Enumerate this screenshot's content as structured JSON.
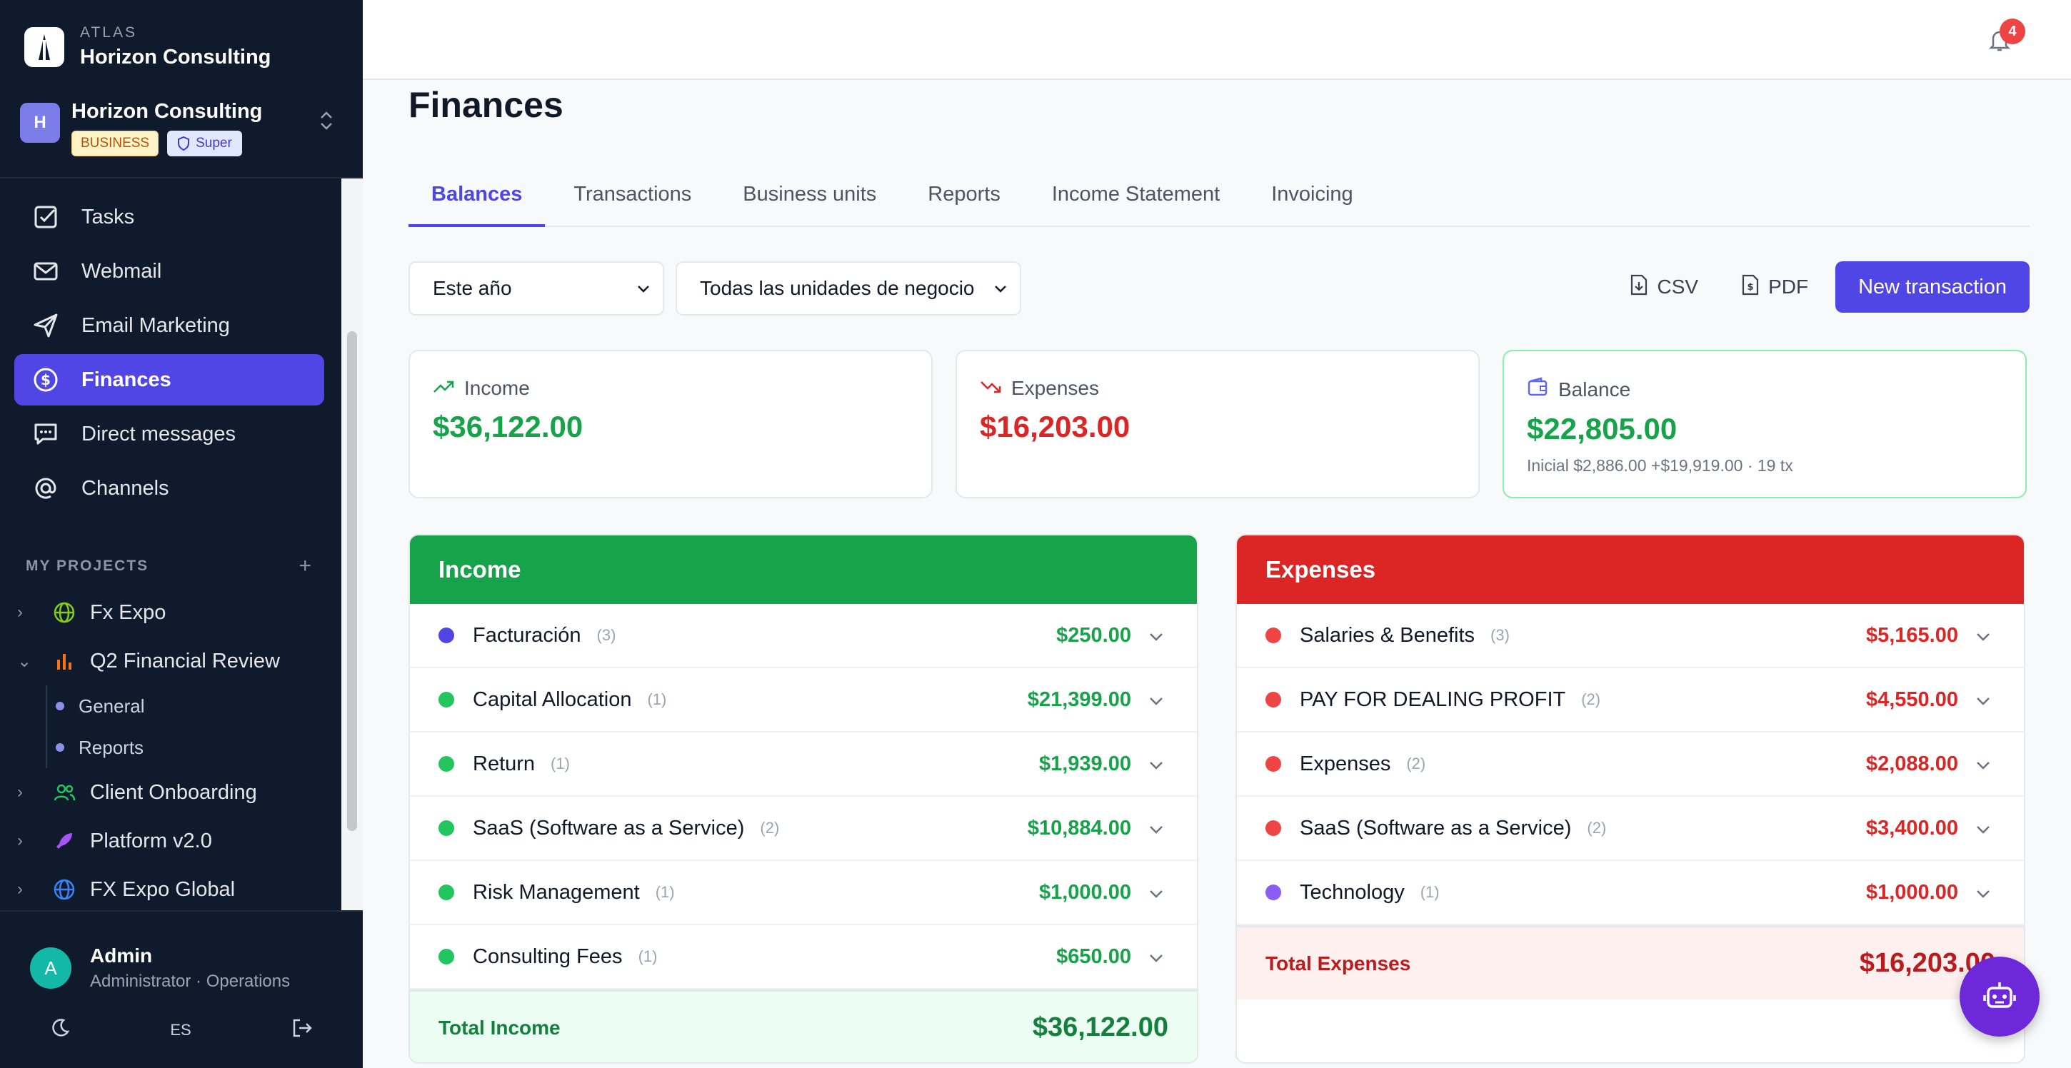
{
  "sidebar": {
    "brand_small": "ATLAS",
    "brand_name": "Horizon Consulting",
    "org": {
      "avatar": "H",
      "name": "Horizon Consulting",
      "badge_plan": "BUSINESS",
      "badge_role": "Super"
    },
    "nav": [
      {
        "label": "Tasks",
        "icon": "check-square-icon"
      },
      {
        "label": "Webmail",
        "icon": "mail-icon"
      },
      {
        "label": "Email Marketing",
        "icon": "send-icon"
      },
      {
        "label": "Finances",
        "icon": "dollar-circle-icon"
      },
      {
        "label": "Direct messages",
        "icon": "chat-icon"
      },
      {
        "label": "Channels",
        "icon": "at-icon"
      }
    ],
    "projects_heading": "MY PROJECTS",
    "projects": [
      {
        "label": "Fx Expo"
      },
      {
        "label": "Q2 Financial Review",
        "children": [
          "General",
          "Reports"
        ]
      },
      {
        "label": "Client Onboarding"
      },
      {
        "label": "Platform v2.0"
      },
      {
        "label": "FX Expo Global"
      }
    ],
    "user": {
      "avatar": "A",
      "name": "Admin",
      "role": "Administrator · Operations"
    },
    "language": "ES"
  },
  "topbar": {
    "notifications": "4"
  },
  "page": {
    "title": "Finances",
    "tabs": [
      "Balances",
      "Transactions",
      "Business units",
      "Reports",
      "Income Statement",
      "Invoicing"
    ],
    "filters": {
      "period": "Este año",
      "unit": "Todas las unidades de negocio"
    },
    "actions": {
      "csv": "CSV",
      "pdf": "PDF",
      "new": "New transaction"
    }
  },
  "summary": {
    "income": {
      "label": "Income",
      "value": "$36,122.00"
    },
    "expenses": {
      "label": "Expenses",
      "value": "$16,203.00"
    },
    "balance": {
      "label": "Balance",
      "value": "$22,805.00",
      "detail": "Inicial $2,886.00 +$19,919.00 · 19 tx"
    }
  },
  "income_panel": {
    "title": "Income",
    "rows": [
      {
        "name": "Facturación",
        "count": "(3)",
        "amount": "$250.00"
      },
      {
        "name": "Capital Allocation",
        "count": "(1)",
        "amount": "$21,399.00"
      },
      {
        "name": "Return",
        "count": "(1)",
        "amount": "$1,939.00"
      },
      {
        "name": "SaaS (Software as a Service)",
        "count": "(2)",
        "amount": "$10,884.00"
      },
      {
        "name": "Risk Management",
        "count": "(1)",
        "amount": "$1,000.00"
      },
      {
        "name": "Consulting Fees",
        "count": "(1)",
        "amount": "$650.00"
      }
    ],
    "total_label": "Total Income",
    "total_value": "$36,122.00"
  },
  "expenses_panel": {
    "title": "Expenses",
    "rows": [
      {
        "name": "Salaries & Benefits",
        "count": "(3)",
        "amount": "$5,165.00"
      },
      {
        "name": "PAY FOR DEALING PROFIT",
        "count": "(2)",
        "amount": "$4,550.00"
      },
      {
        "name": "Expenses",
        "count": "(2)",
        "amount": "$2,088.00"
      },
      {
        "name": "SaaS (Software as a Service)",
        "count": "(2)",
        "amount": "$3,400.00"
      },
      {
        "name": "Technology",
        "count": "(1)",
        "amount": "$1,000.00"
      }
    ],
    "total_label": "Total Expenses",
    "total_value": "$16,203.00"
  },
  "colors": {
    "accent": "#4f46e5",
    "income": "#16a34a",
    "expense": "#dc2626",
    "sidebar": "#0f1b2d"
  }
}
